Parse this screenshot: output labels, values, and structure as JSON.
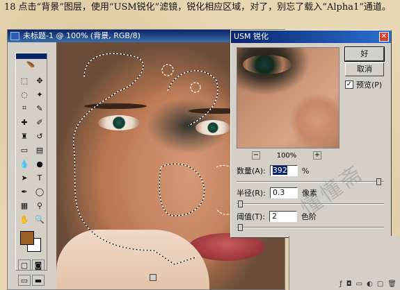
{
  "caption": {
    "step_number": "18",
    "text": "点击“背景”图层，使用“USM锐化”滤镜，锐化相应区域，对了，别忘了载入“Alpha1”通道。"
  },
  "document_window": {
    "title": "未标题-1 @ 100% (背景, RGB/8)"
  },
  "toolbox": {
    "tools": [
      "marquee",
      "move",
      "lasso",
      "magic-wand",
      "crop",
      "slice",
      "healing",
      "brush",
      "stamp",
      "history-brush",
      "eraser",
      "gradient",
      "blur",
      "dodge",
      "path-select",
      "type",
      "pen",
      "shape",
      "notes",
      "eyedropper",
      "hand",
      "zoom"
    ],
    "foreground_color": "#9b6228",
    "background_color": "#ffffff"
  },
  "dialog": {
    "title": "USM 锐化",
    "ok_label": "好",
    "cancel_label": "取消",
    "preview_label": "预览(P)",
    "preview_checked": true,
    "zoom_minus": "−",
    "zoom_level": "100%",
    "zoom_plus": "+",
    "amount": {
      "label": "数量(A):",
      "value": "392",
      "unit": "%",
      "slider_fraction": 0.98
    },
    "radius": {
      "label": "半径(R):",
      "value": "0.3",
      "unit": "像素",
      "slider_fraction": 0.01
    },
    "threshold": {
      "label": "阈值(T):",
      "value": "2",
      "unit": "色阶",
      "slider_fraction": 0.01
    }
  },
  "watermark": "懂懂斋"
}
